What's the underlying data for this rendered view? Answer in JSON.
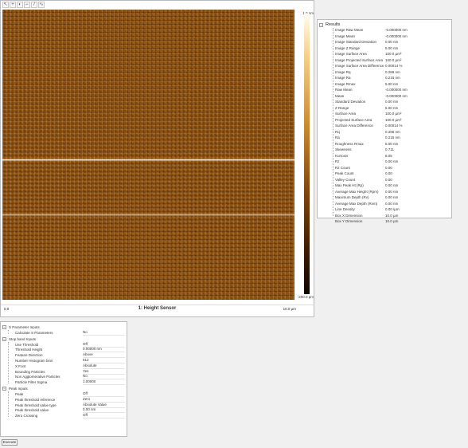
{
  "viewer": {
    "toolbar": [
      {
        "icon": "pointer-icon",
        "glyph": "↖"
      },
      {
        "icon": "zoom-icon",
        "glyph": "+"
      },
      {
        "icon": "color-icon",
        "glyph": "◐"
      },
      {
        "icon": "crop-icon",
        "glyph": "⌐"
      },
      {
        "icon": "line-icon",
        "glyph": "/"
      },
      {
        "icon": "profile-icon",
        "glyph": "∿"
      }
    ],
    "image_title": "1: Height Sensor",
    "colorbar_max": "1.0 nm",
    "colorbar_min": "-200.0 pm",
    "axis_min": "0.0",
    "axis_max": "10.0 µm"
  },
  "results": {
    "title": "Results",
    "rows": [
      {
        "label": "Image Raw Mean",
        "value": "-0.000000 nm"
      },
      {
        "label": "Image Mean",
        "value": "-0.000000 nm"
      },
      {
        "label": "Image Standard Deviation",
        "value": "0.00 nm"
      },
      {
        "label": "Image Z Range",
        "value": "5.00 nm"
      },
      {
        "label": "Image Surface Area",
        "value": "100.0 µm²"
      },
      {
        "label": "Image Projected Surface Area",
        "value": "100.0 µm²"
      },
      {
        "label": "Image Surface Area Difference",
        "value": "0.00014 %"
      },
      {
        "label": "Image Rq",
        "value": "0.286 nm"
      },
      {
        "label": "Image Ra",
        "value": "0.215 nm"
      },
      {
        "label": "Image Rmax",
        "value": "5.00 nm"
      },
      {
        "label": "Raw Mean",
        "value": "-0.000000 nm"
      },
      {
        "label": "Mean",
        "value": "-0.000000 nm"
      },
      {
        "label": "Standard Deviation",
        "value": "0.00 nm"
      },
      {
        "label": "Z Range",
        "value": "5.00 nm"
      },
      {
        "label": "Surface Area",
        "value": "100.0 µm²"
      },
      {
        "label": "Projected Surface Area",
        "value": "100.0 µm²"
      },
      {
        "label": "Surface Area Difference",
        "value": "0.00014 %"
      },
      {
        "label": "Rq",
        "value": "0.286 nm"
      },
      {
        "label": "Ra",
        "value": "0.215 nm"
      },
      {
        "label": "Roughness Rmax",
        "value": "5.00 nm"
      },
      {
        "label": "Skewness",
        "value": "0.711"
      },
      {
        "label": "Kurtosis",
        "value": "8.05"
      },
      {
        "label": "Rz",
        "value": "0.00 nm"
      },
      {
        "label": "Rz Count",
        "value": "0.00"
      },
      {
        "label": "Peak Count",
        "value": "0.00"
      },
      {
        "label": "Valley Count",
        "value": "0.00"
      },
      {
        "label": "Max Peak Ht (Rp)",
        "value": "0.00 nm"
      },
      {
        "label": "Average Max Height (Rpm)",
        "value": "0.00 nm"
      },
      {
        "label": "Maximum Depth (Rv)",
        "value": "0.00 nm"
      },
      {
        "label": "Average Max Depth (Rvm)",
        "value": "0.00 nm"
      },
      {
        "label": "Line Density",
        "value": "0.00 /µm"
      },
      {
        "label": "Box X Dimension",
        "value": "10.0 µm"
      },
      {
        "label": "Box Y Dimension",
        "value": "10.0 µm"
      }
    ]
  },
  "params": {
    "sections": [
      {
        "title": "S Parameter Inputs",
        "rows": [
          {
            "label": "Calculate S Parameters",
            "value": "No"
          }
        ]
      },
      {
        "title": "Stop band Inputs",
        "rows": [
          {
            "label": "Use Threshold",
            "value": "Off"
          },
          {
            "label": "Threshold Height",
            "value": "0.00000 nm"
          },
          {
            "label": "Feature Direction",
            "value": "Above"
          },
          {
            "label": "Number Histogram bins",
            "value": "512"
          },
          {
            "label": "X Font",
            "value": "Absolute"
          },
          {
            "label": "Bounding Particles",
            "value": "Yes"
          },
          {
            "label": "Non Agglomerative Particles",
            "value": "No"
          },
          {
            "label": "Particle Filter Sigma",
            "value": "1.00000"
          }
        ]
      },
      {
        "title": "Peak Inputs",
        "rows": [
          {
            "label": "Peak",
            "value": "Off"
          },
          {
            "label": "Peak threshold reference",
            "value": "Zero"
          },
          {
            "label": "Peak threshold value type",
            "value": "Absolute Value"
          },
          {
            "label": "Peak threshold value",
            "value": "0.00 nm"
          },
          {
            "label": "Zero Crossing",
            "value": "Off"
          }
        ]
      }
    ]
  },
  "execute_label": "Execute"
}
